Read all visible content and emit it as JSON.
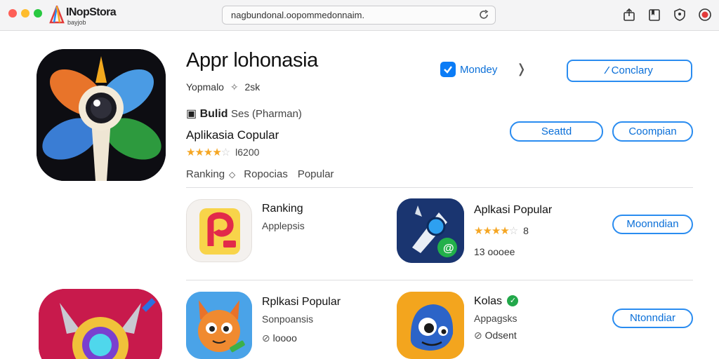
{
  "browser": {
    "brand_name": "INopStora",
    "brand_sub": "bayjob",
    "url": "nagbundonal.oopommedonnaim.",
    "colors": {
      "close": "#fe5f57",
      "minimize": "#febc2e",
      "maximize": "#28c840"
    }
  },
  "toolbar_icons": [
    "share-icon",
    "bookmark-icon",
    "shield-icon",
    "record-icon"
  ],
  "hero": {
    "title": "Appr lohonasia",
    "meta_left": "Yopmalo",
    "meta_right": "2sk",
    "developer_bold": "Bulid",
    "developer_rest": "Ses (Pharman)",
    "category": "Aplikasia Copular",
    "rating_count": "l6200",
    "rating": 4,
    "tabs": [
      "Ranking",
      "Ropocias",
      "Popular"
    ],
    "monday_label": "Mondey",
    "contact_button": "Conclary",
    "share_button": "Seattd",
    "complain_button": "Coompian"
  },
  "apps": [
    {
      "title": "Ranking",
      "subtitle": "Applepsis"
    },
    {
      "title": "Aplkasi Popular",
      "rating_count": "8",
      "downloads": "13 oooee",
      "rating": 4,
      "button": "Moonndian"
    },
    {
      "title": "Rplkasi Popular",
      "subtitle": "Sonpoansis",
      "extra": "loooo"
    },
    {
      "title": "Kolas",
      "subtitle": "Appagsks",
      "extra": "Odsent",
      "button": "Ntonndiar"
    }
  ],
  "accent_color": "#0a6fd8"
}
